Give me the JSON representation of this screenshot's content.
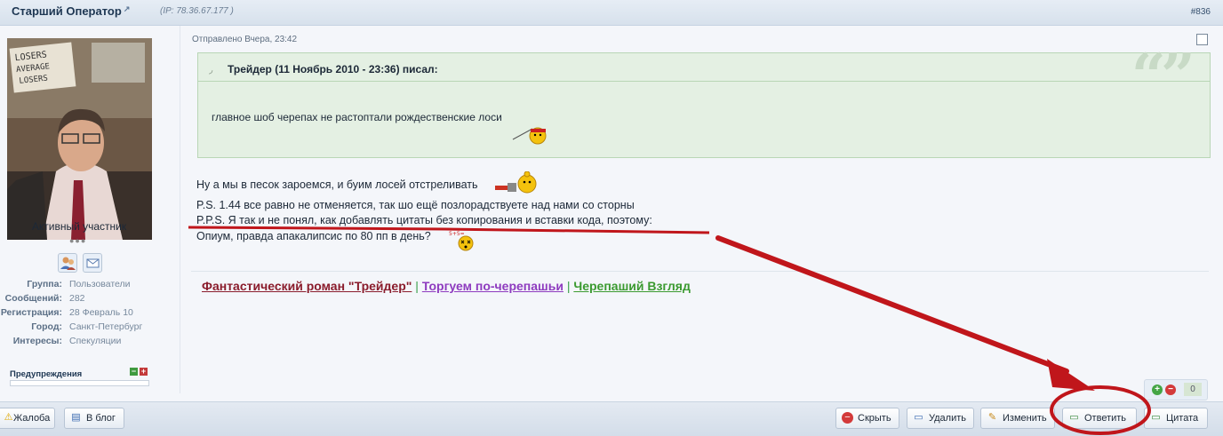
{
  "post": {
    "author": "Старший Оператор",
    "ip": "(IP: 78.36.67.177 )",
    "number": "#836",
    "posted": "Отправлено Вчера, 23:42"
  },
  "profile": {
    "avatar_text": [
      "LOSERS",
      "AVERAGE",
      "LOSERS"
    ],
    "rank": "Активный участник",
    "pips": "●●●",
    "stats": [
      {
        "label": "Группа:",
        "value": "Пользователи"
      },
      {
        "label": "Сообщений:",
        "value": "282"
      },
      {
        "label": "Регистрация:",
        "value": "28 Февраль 10"
      },
      {
        "label": "Город:",
        "value": "Санкт-Петербург"
      },
      {
        "label": "Интересы:",
        "value": "Спекуляции"
      }
    ],
    "warnings_label": "Предупреждения"
  },
  "quote": {
    "title": "Трейдер (11 Ноябрь 2010 - 23:36) писал:",
    "text": "главное шоб черепах не растоптали рождественские лоси"
  },
  "body": {
    "lines": [
      "Ну а мы в песок зароемся, и буим лосей отстреливать",
      "P.S. 1.44 все равно не отменяется, так шо ещё позлорадствуете над нами со сторны",
      "P.P.S. Я так и не понял, как добавлять цитаты без копирования и вставки кода, поэтому:",
      "Опиум, правда апакалипсис по 80 пп в день?"
    ]
  },
  "signature": {
    "link1": "Фантастический роман \"Трейдер\"",
    "sep1": "|",
    "link2": "Торгуем по-черепашьи",
    "sep2": "|",
    "link3": "Черепаший Взгляд"
  },
  "reputation": {
    "count": "0"
  },
  "buttons": {
    "report": "Жалоба",
    "blog": "В блог",
    "hide": "Скрыть",
    "delete": "Удалить",
    "edit": "Изменить",
    "reply": "Ответить",
    "quote": "Цитата"
  },
  "colors": {
    "annotation": "#c0161b",
    "quote_bg": "#e4f0e3",
    "header_text": "#1d3652"
  }
}
